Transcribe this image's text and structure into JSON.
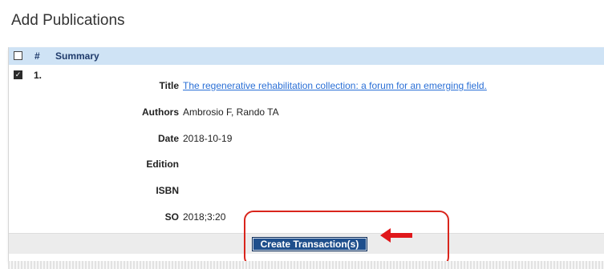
{
  "page": {
    "title": "Add Publications"
  },
  "table": {
    "headers": {
      "select_all": "",
      "number": "#",
      "summary": "Summary"
    },
    "rows": [
      {
        "checked": true,
        "number": "1.",
        "fields": {
          "title_label": "Title",
          "title_value": "The regenerative rehabilitation collection: a forum for an emerging field.",
          "authors_label": "Authors",
          "authors_value": "Ambrosio F, Rando TA",
          "date_label": "Date",
          "date_value": "2018-10-19",
          "edition_label": "Edition",
          "edition_value": "",
          "isbn_label": "ISBN",
          "isbn_value": "",
          "so_label": "SO",
          "so_value": "2018;3:20"
        }
      }
    ]
  },
  "footer": {
    "create_button_label": "Create Transaction(s)"
  },
  "annotations": {
    "highlight_color": "#d9251c",
    "arrow_icon": "left-arrow-icon"
  },
  "colors": {
    "header_bg": "#cfe3f5",
    "button_bg": "#1f4f8c",
    "link": "#2a6fd6"
  }
}
